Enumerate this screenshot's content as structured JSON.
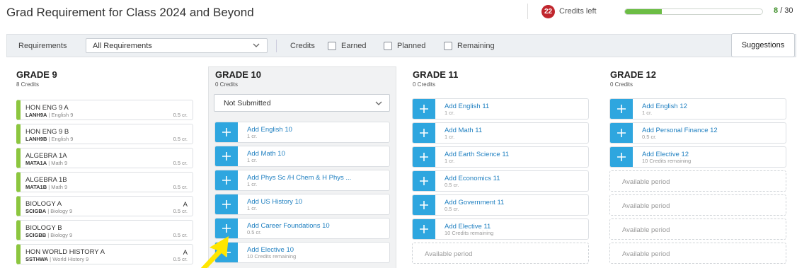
{
  "header": {
    "title": "Grad Requirement for Class 2024 and Beyond",
    "credits_left_count": "22",
    "credits_left_label": "Credits left",
    "progress_fraction": 0.267,
    "progress_earned": "8",
    "progress_total": "/ 30"
  },
  "filters": {
    "requirements_label": "Requirements",
    "requirements_value": "All Requirements",
    "credits_label": "Credits",
    "earned_label": "Earned",
    "planned_label": "Planned",
    "remaining_label": "Remaining",
    "suggestions_label": "Suggestions"
  },
  "grades": {
    "g9": {
      "heading": "GRADE 9",
      "credits": "8 Credits",
      "courses": [
        {
          "name": "HON ENG 9 A",
          "code": "LANH9A",
          "subject": "English 9",
          "grade": "",
          "credit": "0.5 cr."
        },
        {
          "name": "HON ENG 9 B",
          "code": "LANH9B",
          "subject": "English 9",
          "grade": "",
          "credit": "0.5 cr."
        },
        {
          "name": "ALGEBRA 1A",
          "code": "MATA1A",
          "subject": "Math 9",
          "grade": "",
          "credit": "0.5 cr."
        },
        {
          "name": "ALGEBRA 1B",
          "code": "MATA1B",
          "subject": "Math 9",
          "grade": "",
          "credit": "0.5 cr."
        },
        {
          "name": "BIOLOGY A",
          "code": "SCIGBA",
          "subject": "Biology 9",
          "grade": "A",
          "credit": "0.5 cr."
        },
        {
          "name": "BIOLOGY B",
          "code": "SCIGBB",
          "subject": "Biology 9",
          "grade": "",
          "credit": "0.5 cr."
        },
        {
          "name": "HON WORLD HISTORY A",
          "code": "SSTHWA",
          "subject": "World History 9",
          "grade": "A",
          "credit": "0.5 cr."
        }
      ]
    },
    "g10": {
      "heading": "GRADE 10",
      "credits": "0 Credits",
      "status": "Not Submitted",
      "adds": [
        {
          "title": "Add English 10",
          "sub": "1 cr."
        },
        {
          "title": "Add Math 10",
          "sub": "1 cr."
        },
        {
          "title": "Add Phys Sc /H Chem & H Phys ...",
          "sub": "1 cr."
        },
        {
          "title": "Add US History 10",
          "sub": "1 cr."
        },
        {
          "title": "Add Career Foundations 10",
          "sub": "0.5 cr."
        },
        {
          "title": "Add Elective 10",
          "sub": "10 Credits remaining"
        }
      ]
    },
    "g11": {
      "heading": "GRADE 11",
      "credits": "0 Credits",
      "adds": [
        {
          "title": "Add English 11",
          "sub": "1 cr."
        },
        {
          "title": "Add Math 11",
          "sub": "1 cr."
        },
        {
          "title": "Add Earth Science 11",
          "sub": "1 cr."
        },
        {
          "title": "Add Economics 11",
          "sub": "0.5 cr."
        },
        {
          "title": "Add Government 11",
          "sub": "0.5 cr."
        },
        {
          "title": "Add Elective 11",
          "sub": "10 Credits remaining"
        }
      ],
      "available": [
        "Available period"
      ]
    },
    "g12": {
      "heading": "GRADE 12",
      "credits": "0 Credits",
      "adds": [
        {
          "title": "Add English 12",
          "sub": "1 cr."
        },
        {
          "title": "Add Personal Finance 12",
          "sub": "0.5 cr."
        },
        {
          "title": "Add Elective 12",
          "sub": "10 Credits remaining"
        }
      ],
      "available": [
        "Available period",
        "Available period",
        "Available period",
        "Available period"
      ]
    }
  },
  "colors": {
    "accent_blue": "#2ea6df",
    "completed_green": "#8cc63f",
    "badge_red": "#c0262d",
    "annotation_arrow": "#ffe600"
  },
  "icons": {
    "plus": "plus-icon",
    "chevron": "chevron-down-icon",
    "arrow": "yellow-pointer-arrow"
  }
}
